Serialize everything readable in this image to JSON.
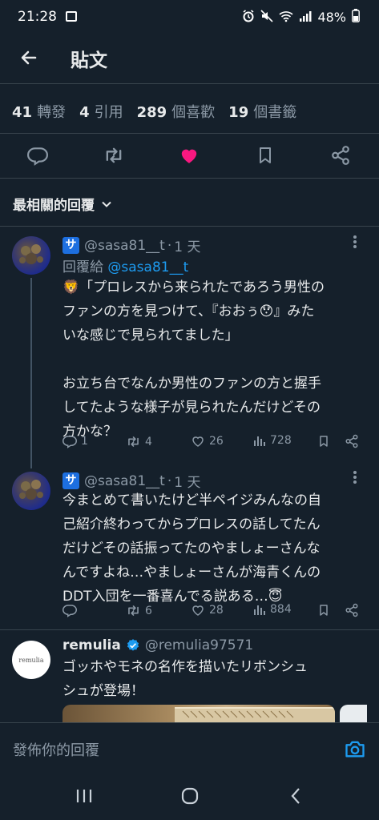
{
  "status_bar": {
    "time": "21:28",
    "battery": "48%"
  },
  "header": {
    "title": "貼文"
  },
  "stats": [
    {
      "num": "41",
      "label": "轉發"
    },
    {
      "num": "4",
      "label": "引用"
    },
    {
      "num": "289",
      "label": "個喜歡"
    },
    {
      "num": "19",
      "label": "個書籤"
    }
  ],
  "sort": {
    "label": "最相關的回覆"
  },
  "replies": [
    {
      "handle": "@sasa81__t",
      "sep": "·",
      "time": "1 天",
      "reply_prefix": "回覆給",
      "reply_mention": "@sasa81__t",
      "text": "🦁「プロレスから来られたであろう男性の\nファンの方を見つけて、『おおぅ😯』みた\nいな感じで見られてました」\n\nお立ち台でなんか男性のファンの方と握手\nしてたような様子が見られたんだけどその\n方かな？",
      "counts": {
        "reply": "1",
        "retweet": "4",
        "like": "26",
        "views": "728"
      }
    },
    {
      "handle": "@sasa81__t",
      "sep": "·",
      "time": "1 天",
      "text": "今まとめて書いたけど半ペイジみんなの自\n己紹介終わってからプロレスの話してたん\nだけどその話振ってたのやましょーさんな\nんですよね…やましょーさんが海青くんの\nDDT入団を一番喜んでる説ある…😇",
      "counts": {
        "reply": "",
        "retweet": "6",
        "like": "28",
        "views": "884"
      }
    }
  ],
  "ad": {
    "name": "remulia",
    "handle": "@remulia97571",
    "logo_text": "remulia",
    "text": "ゴッホやモネの名作を描いたリボンシュ\nシュが登場！"
  },
  "compose": {
    "placeholder": "發佈你的回覆"
  },
  "colors": {
    "accent": "#1d9bf0",
    "like": "#f91880",
    "bg": "#15202b"
  }
}
